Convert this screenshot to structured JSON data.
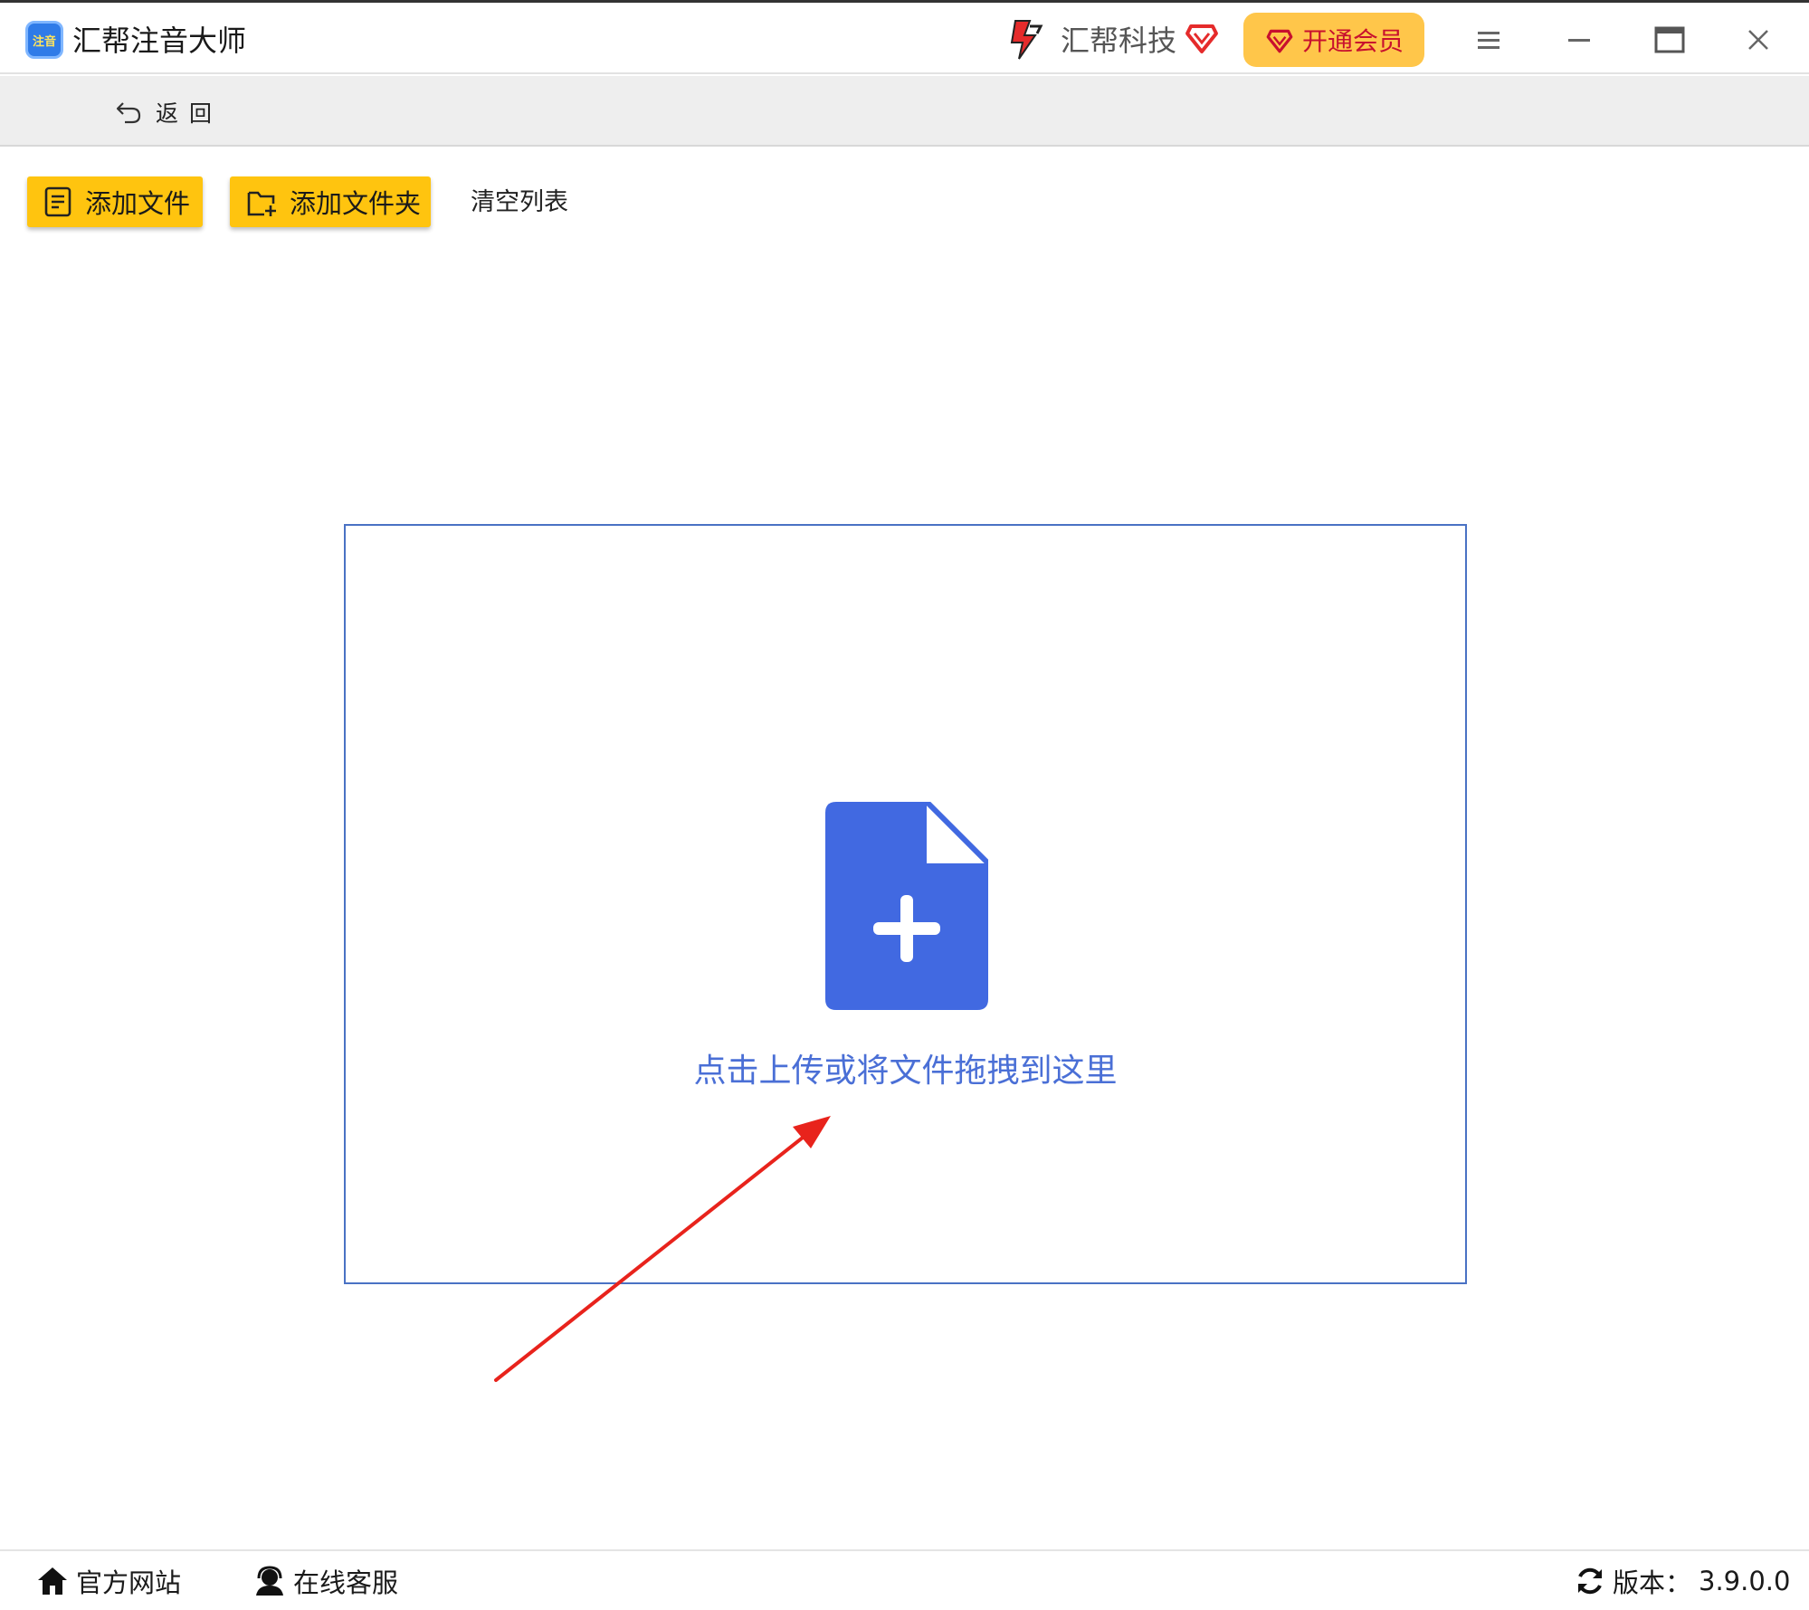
{
  "app": {
    "title": "汇帮注音大师",
    "logo_text": "注音"
  },
  "header": {
    "brand_name": "汇帮科技",
    "vip_label": "开通会员",
    "menu_icon": "hamburger-icon",
    "minimize_icon": "minimize-icon",
    "maximize_icon": "maximize-icon",
    "close_icon": "close-icon"
  },
  "nav": {
    "back_label": "返回"
  },
  "toolbar": {
    "add_file_label": "添加文件",
    "add_folder_label": "添加文件夹",
    "clear_list_label": "清空列表"
  },
  "dropzone": {
    "prompt": "点击上传或将文件拖拽到这里",
    "icon": "file-add-icon"
  },
  "footer": {
    "website_label": "官方网站",
    "support_label": "在线客服",
    "version_label": "版本：",
    "version_value": "3.9.0.0"
  },
  "colors": {
    "accent_yellow": "#ffc40f",
    "vip_bg": "#ffc64a",
    "vip_text": "#c8102e",
    "drop_border": "#4a72c4",
    "drop_icon": "#4169e1",
    "drop_text": "#4a6fd6",
    "annotation_arrow": "#e8231c"
  }
}
